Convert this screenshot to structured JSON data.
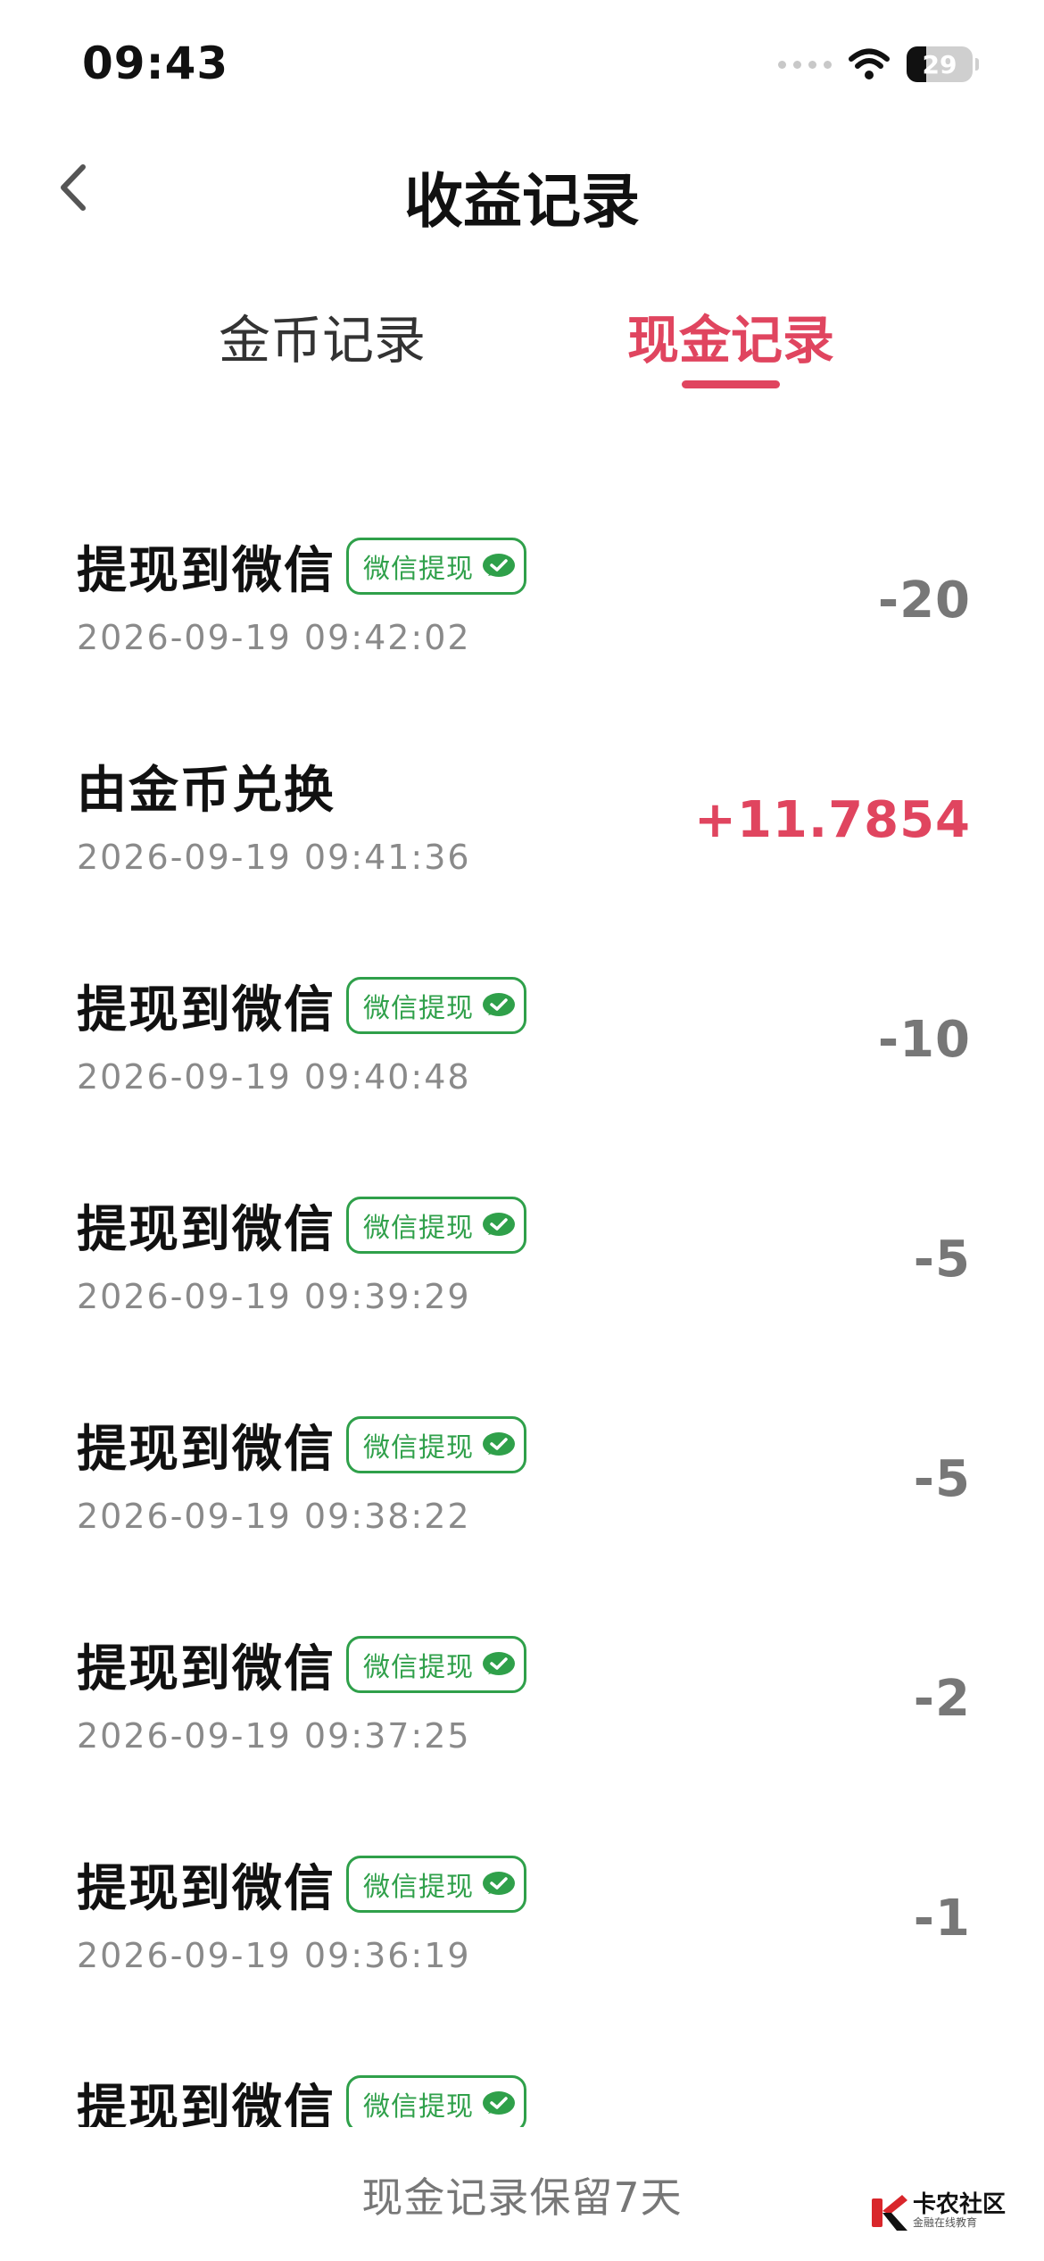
{
  "status_bar": {
    "time": "09:43",
    "battery": "29"
  },
  "header": {
    "title": "收益记录"
  },
  "tabs": [
    {
      "label": "金币记录",
      "active": false
    },
    {
      "label": "现金记录",
      "active": true
    }
  ],
  "badge_label": "微信提现",
  "records": [
    {
      "title": "提现到微信",
      "badge": true,
      "time": "2026-09-19 09:42:02",
      "amount": "-20"
    },
    {
      "title": "由金币兑换",
      "badge": false,
      "time": "2026-09-19 09:41:36",
      "amount": "+11.7854"
    },
    {
      "title": "提现到微信",
      "badge": true,
      "time": "2026-09-19 09:40:48",
      "amount": "-10"
    },
    {
      "title": "提现到微信",
      "badge": true,
      "time": "2026-09-19 09:39:29",
      "amount": "-5"
    },
    {
      "title": "提现到微信",
      "badge": true,
      "time": "2026-09-19 09:38:22",
      "amount": "-5"
    },
    {
      "title": "提现到微信",
      "badge": true,
      "time": "2026-09-19 09:37:25",
      "amount": "-2"
    },
    {
      "title": "提现到微信",
      "badge": true,
      "time": "2026-09-19 09:36:19",
      "amount": "-1"
    },
    {
      "title": "提现到微信",
      "badge": true,
      "time": "",
      "amount": ""
    }
  ],
  "footer": {
    "note": "现金记录保留7天"
  },
  "watermark": {
    "name": "卡农社区",
    "tagline": "金融在线教育"
  },
  "colors": {
    "accent": "#e0455f",
    "wechat_green": "#2fa04a",
    "muted_amount": "#777777"
  },
  "icons": {
    "back": "chevron-left-icon",
    "wechat": "wechat-icon",
    "wifi": "wifi-icon"
  }
}
